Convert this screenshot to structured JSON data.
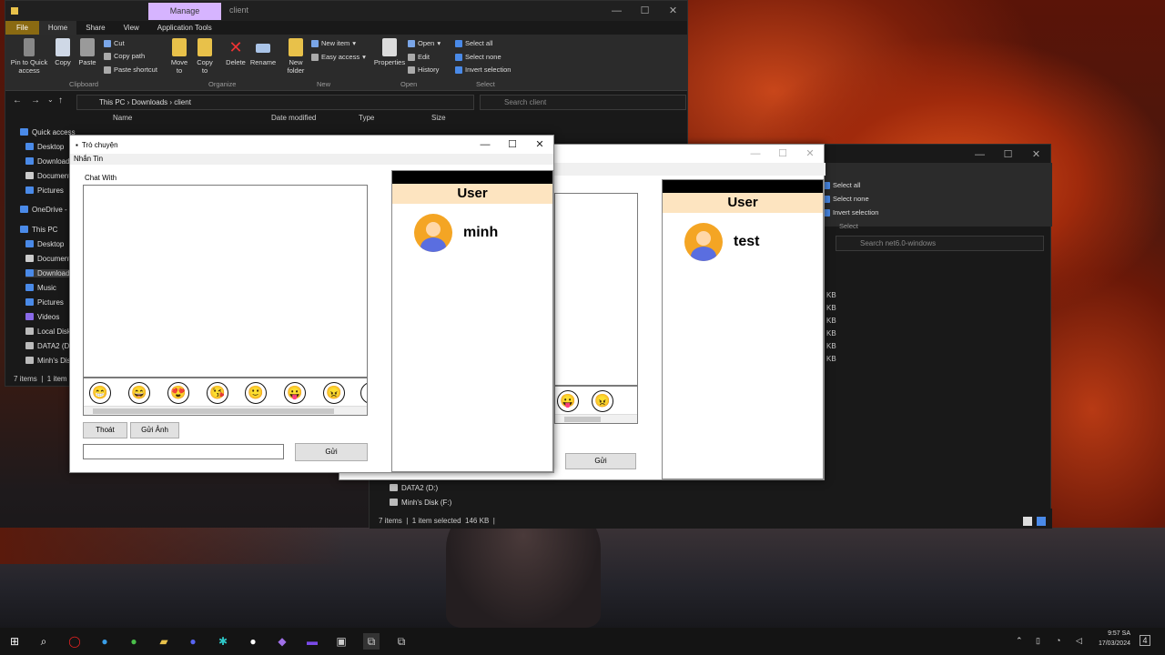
{
  "explorer_main": {
    "manage_tab": "Manage",
    "title": "client",
    "tabs": [
      "File",
      "Home",
      "Share",
      "View",
      "Application Tools"
    ],
    "clipboard": {
      "pin": "Pin to Quick access",
      "copy": "Copy",
      "paste": "Paste",
      "cut": "Cut",
      "copy_path": "Copy path",
      "paste_shortcut": "Paste shortcut",
      "group": "Clipboard"
    },
    "organize": {
      "move": "Move to",
      "copy": "Copy to",
      "delete": "Delete",
      "rename": "Rename",
      "group": "Organize"
    },
    "new": {
      "folder": "New folder",
      "item": "New item",
      "easy": "Easy access",
      "group": "New"
    },
    "open": {
      "properties": "Properties",
      "open": "Open",
      "edit": "Edit",
      "history": "History",
      "group": "Open"
    },
    "select": {
      "all": "Select all",
      "none": "None",
      "invert": "Invert selection",
      "group": "Select",
      "none_label": "Select none"
    },
    "breadcrumb": [
      "This PC",
      "Downloads",
      "client"
    ],
    "search_placeholder": "Search client",
    "columns": [
      "Name",
      "Date modified",
      "Type",
      "Size"
    ],
    "nav": [
      "Quick access",
      "Desktop",
      "Download",
      "Document",
      "Pictures",
      "OneDrive - ",
      "This PC",
      "Desktop",
      "Document",
      "Download",
      "Music",
      "Pictures",
      "Videos",
      "Local Disk",
      "DATA2 (D:",
      "Minh's Dis"
    ],
    "status": "7 items",
    "status2": "1 item"
  },
  "explorer_back": {
    "select_all": "Select all",
    "select_none": "Select none",
    "invert": "Invert selection",
    "group": "Select",
    "search_placeholder": "Search net6.0-windows",
    "sizes": [
      "KB",
      "KB",
      "KB",
      "KB",
      "KB",
      "KB"
    ],
    "nav": [
      "DATA2 (D:)",
      "Minh's Disk (F:)"
    ],
    "status": "7 items",
    "selected": "1 item selected",
    "size": "146 KB"
  },
  "chat1": {
    "title": "Trò chuyện",
    "tab": "Nhắn Tin",
    "chat_with": "Chat With",
    "exit": "Thoát",
    "send_image": "Gửi Ảnh",
    "send": "Gửi",
    "panel_title": "User",
    "user": "minh"
  },
  "chat2": {
    "send": "Gửi",
    "panel_title": "User",
    "user": "test"
  },
  "emojis": [
    "😁",
    "😄",
    "😍",
    "😘",
    "🙂",
    "😛",
    "😠"
  ],
  "emojis2": [
    "😛",
    "😠"
  ],
  "tray": {
    "time": "9:57 SA",
    "date": "17/03/2024",
    "notif": "4"
  }
}
